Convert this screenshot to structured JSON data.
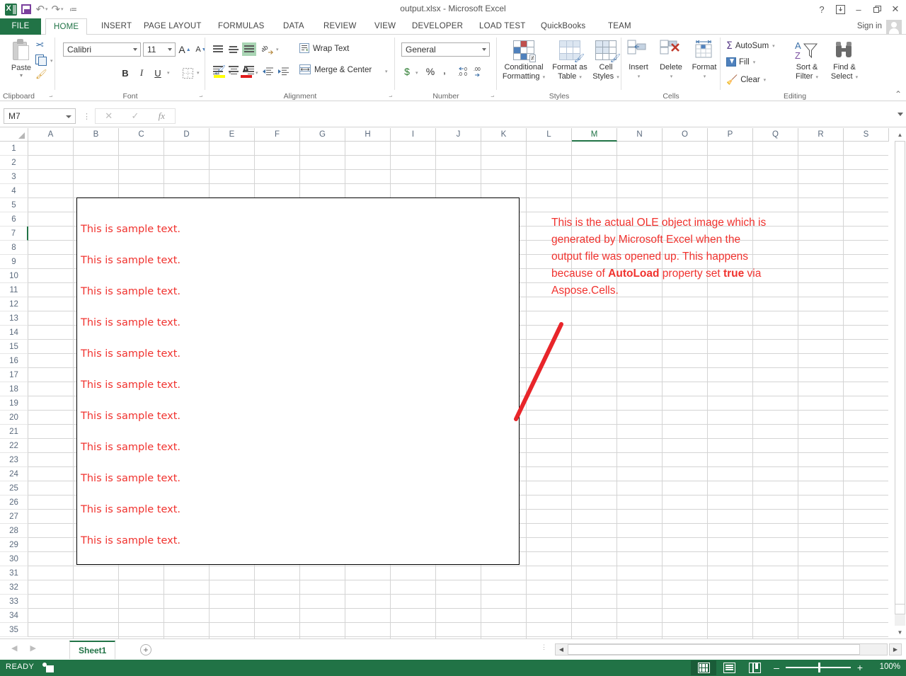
{
  "window": {
    "title": "output.xlsx - Microsoft Excel",
    "help_icon": "?",
    "ribbon_display_icon": "ribbon-display",
    "minimize_icon": "–",
    "restore_icon": "❐",
    "close_icon": "✕"
  },
  "quick_access": {
    "app_logo": "excel-logo",
    "save": "save-icon",
    "undo": "↶",
    "redo": "↷",
    "customize": "≔"
  },
  "tabs": [
    {
      "label": "FILE",
      "type": "file"
    },
    {
      "label": "HOME",
      "type": "active"
    },
    {
      "label": "INSERT",
      "type": "normal"
    },
    {
      "label": "PAGE LAYOUT",
      "type": "normal"
    },
    {
      "label": "FORMULAS",
      "type": "normal"
    },
    {
      "label": "DATA",
      "type": "normal"
    },
    {
      "label": "REVIEW",
      "type": "normal"
    },
    {
      "label": "VIEW",
      "type": "normal"
    },
    {
      "label": "DEVELOPER",
      "type": "normal"
    },
    {
      "label": "LOAD TEST",
      "type": "normal"
    },
    {
      "label": "QuickBooks",
      "type": "normal"
    },
    {
      "label": "TEAM",
      "type": "normal"
    }
  ],
  "account": {
    "sign_in": "Sign in"
  },
  "ribbon": {
    "groups": [
      {
        "name": "Clipboard"
      },
      {
        "name": "Font"
      },
      {
        "name": "Alignment"
      },
      {
        "name": "Number"
      },
      {
        "name": "Styles"
      },
      {
        "name": "Cells"
      },
      {
        "name": "Editing"
      }
    ],
    "clipboard": {
      "paste": "Paste",
      "cut_icon": "scissors-icon",
      "copy_icon": "copy-icon",
      "format_painter_icon": "format-painter-icon"
    },
    "font": {
      "family": "Calibri",
      "size": "11",
      "grow_font": "A",
      "shrink_font": "A",
      "bold": "B",
      "italic": "I",
      "underline": "U",
      "borders_icon": "borders-icon",
      "fill_color_icon": "fill-color-icon",
      "font_color_icon": "font-color-icon"
    },
    "alignment": {
      "wrap_text": "Wrap Text",
      "merge_center": "Merge & Center",
      "orientation_icon": "orientation-icon",
      "decrease_indent_icon": "decrease-indent-icon",
      "increase_indent_icon": "increase-indent-icon"
    },
    "number": {
      "format": "General",
      "accounting": "$",
      "percent": "%",
      "comma": ",",
      "increase_decimal": ".00",
      "decrease_decimal": ".00"
    },
    "styles": {
      "conditional_formatting": "Conditional\nFormatting",
      "conditional_formatting_l1": "Conditional",
      "conditional_formatting_l2": "Formatting",
      "format_as_table_l1": "Format as",
      "format_as_table_l2": "Table",
      "cell_styles_l1": "Cell",
      "cell_styles_l2": "Styles"
    },
    "cells": {
      "insert": "Insert",
      "delete": "Delete",
      "format": "Format"
    },
    "editing": {
      "autosum": "AutoSum",
      "fill": "Fill",
      "clear": "Clear",
      "sort_filter_l1": "Sort &",
      "sort_filter_l2": "Filter",
      "find_select_l1": "Find &",
      "find_select_l2": "Select"
    },
    "collapse_icon": "⌃"
  },
  "formula_bar": {
    "name_box_value": "M7",
    "cancel_icon": "✕",
    "enter_icon": "✓",
    "insert_function_icon": "fx",
    "formula_value": "",
    "expand_icon": "chevron-down-icon"
  },
  "grid": {
    "columns": [
      "A",
      "B",
      "C",
      "D",
      "E",
      "F",
      "G",
      "H",
      "I",
      "J",
      "K",
      "L",
      "M",
      "N",
      "O",
      "P",
      "Q",
      "R",
      "S"
    ],
    "selected_column": "M",
    "rows": [
      1,
      2,
      3,
      4,
      5,
      6,
      7,
      8,
      9,
      10,
      11,
      12,
      13,
      14,
      15,
      16,
      17,
      18,
      19,
      20,
      21,
      22,
      23,
      24,
      25,
      26,
      27,
      28,
      29,
      30,
      31,
      32,
      33,
      34,
      35
    ],
    "selected_row": 7,
    "active_cell": "M7"
  },
  "ole_object": {
    "lines": [
      "This is sample text.",
      "This is sample text.",
      "This is sample text.",
      "This is sample text.",
      "This is sample text.",
      "This is sample text.",
      "This is sample text.",
      "This is sample text.",
      "This is sample text.",
      "This is sample text.",
      "This is sample text."
    ],
    "text_color": "#f0322e",
    "border_color": "#000000"
  },
  "annotation": {
    "line1": "This is the actual OLE object image which is",
    "line2": "generated by Microsoft Excel when the",
    "line3": "output file was opened up. This happens",
    "line4_pre": "because of ",
    "line4_bold1": "AutoLoad",
    "line4_mid": " property set ",
    "line4_bold2": "true",
    "line4_post": " via",
    "line5": "Aspose.Cells.",
    "color": "#f0322e",
    "arrow_color": "#e8252a"
  },
  "sheet_bar": {
    "prev_icon": "◀",
    "next_icon": "▶",
    "sheets": [
      "Sheet1"
    ],
    "active_sheet": "Sheet1",
    "add_sheet_icon": "+"
  },
  "status_bar": {
    "mode": "READY",
    "macro_record_icon": "record-macro-icon",
    "view_normal_icon": "normal-view-icon",
    "view_page_layout_icon": "page-layout-view-icon",
    "view_page_break_icon": "page-break-view-icon",
    "active_view": "normal",
    "zoom_out": "–",
    "zoom_in": "+",
    "zoom_level": "100%"
  }
}
